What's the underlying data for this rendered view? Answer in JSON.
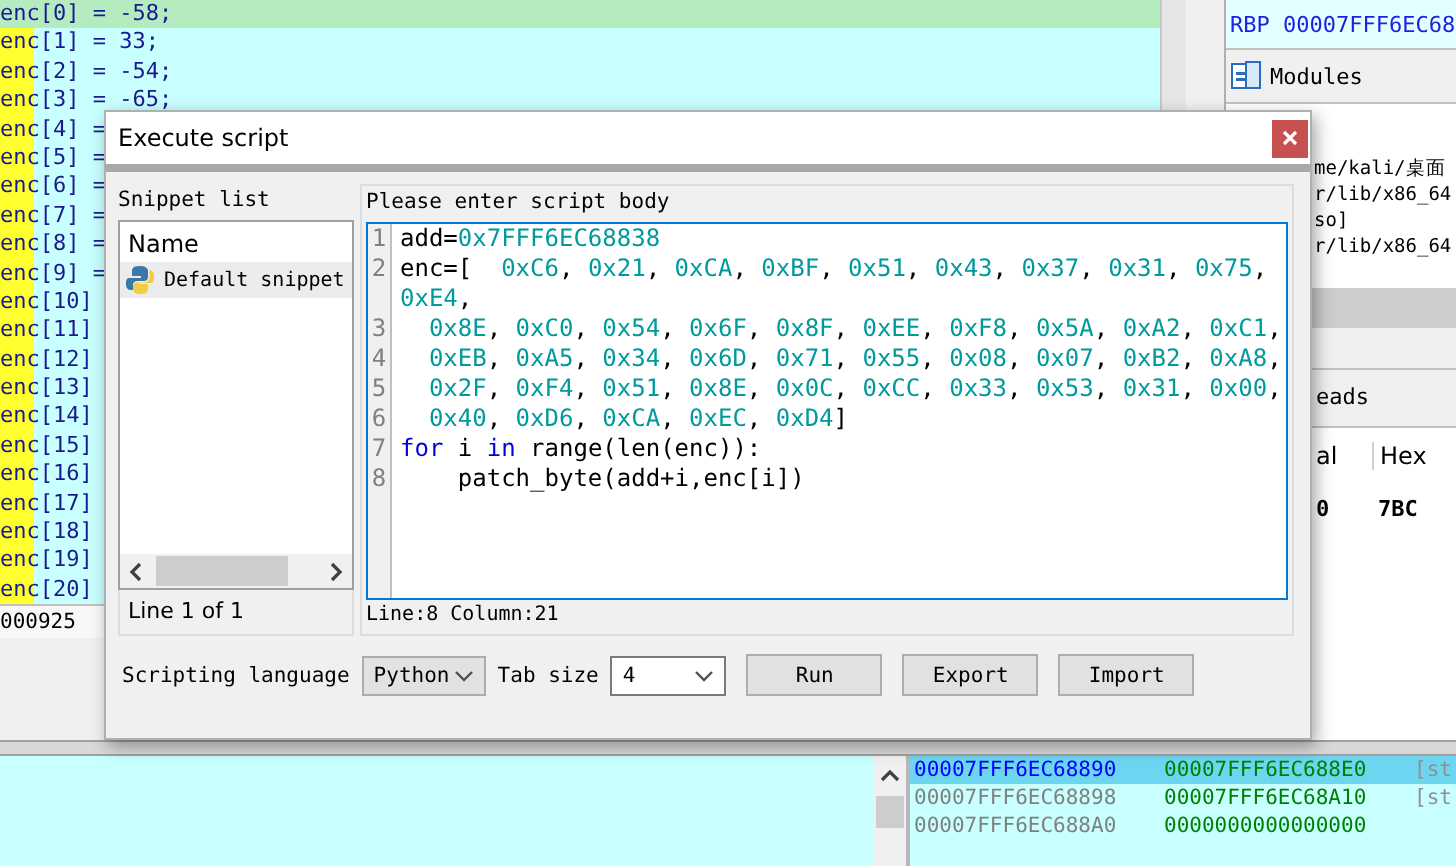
{
  "pseudocode": {
    "lines": [
      {
        "text": "enc[0] = -58;",
        "selected": true
      },
      {
        "text": "enc[1] = 33;",
        "selected": false
      },
      {
        "text": "enc[2] = -54;",
        "selected": false
      },
      {
        "text": "enc[3] = -65;",
        "selected": false
      },
      {
        "text": "enc[4] =",
        "selected": false
      },
      {
        "text": "enc[5] =",
        "selected": false
      },
      {
        "text": "enc[6] =",
        "selected": false
      },
      {
        "text": "enc[7] =",
        "selected": false
      },
      {
        "text": "enc[8] =",
        "selected": false
      },
      {
        "text": "enc[9] =",
        "selected": false
      },
      {
        "text": "enc[10]",
        "selected": false
      },
      {
        "text": "enc[11]",
        "selected": false
      },
      {
        "text": "enc[12]",
        "selected": false
      },
      {
        "text": "enc[13]",
        "selected": false
      },
      {
        "text": "enc[14]",
        "selected": false
      },
      {
        "text": "enc[15]",
        "selected": false
      },
      {
        "text": "enc[16]",
        "selected": false
      },
      {
        "text": "enc[17]",
        "selected": false
      },
      {
        "text": "enc[18]",
        "selected": false
      },
      {
        "text": "enc[19]",
        "selected": false
      },
      {
        "text": "enc[20]",
        "selected": false
      }
    ],
    "status": "000925"
  },
  "registers": {
    "line": "RBP 00007FFF6EC68"
  },
  "modules": {
    "title": "Modules",
    "items": [
      "me/kali/桌面",
      "r/lib/x86_64",
      "so]",
      "r/lib/x86_64"
    ]
  },
  "threads": {
    "tab": "eads",
    "columns": [
      "al",
      "Hex"
    ],
    "rows": [
      [
        "0",
        "7BC"
      ]
    ]
  },
  "hex_dump": {
    "rows": [
      {
        "address": "00007FFF6EC68890",
        "value": "00007FFF6EC688E0",
        "comment": "[st",
        "selected": true
      },
      {
        "address": "00007FFF6EC68898",
        "value": "00007FFF6EC68A10",
        "comment": "[st",
        "selected": false
      },
      {
        "address": "00007FFF6EC688A0",
        "value": "0000000000000000",
        "selected": false
      }
    ]
  },
  "dialog": {
    "title": "Execute script",
    "snippet_list": {
      "label": "Snippet list",
      "column": "Name",
      "items": [
        {
          "name": "Default snippet",
          "selected": true
        }
      ],
      "status": "Line 1 of 1"
    },
    "editor": {
      "label": "Please enter script body",
      "lines": [
        {
          "number": "1",
          "tokens": [
            {
              "kind": "plain",
              "text": "add="
            },
            {
              "kind": "number",
              "text": "0x7FFF6EC68838"
            }
          ]
        },
        {
          "number": "2",
          "tokens": [
            {
              "kind": "plain",
              "text": "enc=[  "
            },
            {
              "kind": "number",
              "text": "0xC6"
            },
            {
              "kind": "plain",
              "text": ", "
            },
            {
              "kind": "number",
              "text": "0x21"
            },
            {
              "kind": "plain",
              "text": ", "
            },
            {
              "kind": "number",
              "text": "0xCA"
            },
            {
              "kind": "plain",
              "text": ", "
            },
            {
              "kind": "number",
              "text": "0xBF"
            },
            {
              "kind": "plain",
              "text": ", "
            },
            {
              "kind": "number",
              "text": "0x51"
            },
            {
              "kind": "plain",
              "text": ", "
            },
            {
              "kind": "number",
              "text": "0x43"
            },
            {
              "kind": "plain",
              "text": ", "
            },
            {
              "kind": "number",
              "text": "0x37"
            },
            {
              "kind": "plain",
              "text": ", "
            },
            {
              "kind": "number",
              "text": "0x31"
            },
            {
              "kind": "plain",
              "text": ", "
            },
            {
              "kind": "number",
              "text": "0x75"
            },
            {
              "kind": "plain",
              "text": ", "
            },
            {
              "kind": "number",
              "text": "0xE4"
            },
            {
              "kind": "plain",
              "text": ","
            }
          ]
        },
        {
          "number": "3",
          "indented": true,
          "tokens": [
            {
              "kind": "number",
              "text": "0x8E"
            },
            {
              "kind": "plain",
              "text": ", "
            },
            {
              "kind": "number",
              "text": "0xC0"
            },
            {
              "kind": "plain",
              "text": ", "
            },
            {
              "kind": "number",
              "text": "0x54"
            },
            {
              "kind": "plain",
              "text": ", "
            },
            {
              "kind": "number",
              "text": "0x6F"
            },
            {
              "kind": "plain",
              "text": ", "
            },
            {
              "kind": "number",
              "text": "0x8F"
            },
            {
              "kind": "plain",
              "text": ", "
            },
            {
              "kind": "number",
              "text": "0xEE"
            },
            {
              "kind": "plain",
              "text": ", "
            },
            {
              "kind": "number",
              "text": "0xF8"
            },
            {
              "kind": "plain",
              "text": ", "
            },
            {
              "kind": "number",
              "text": "0x5A"
            },
            {
              "kind": "plain",
              "text": ", "
            },
            {
              "kind": "number",
              "text": "0xA2"
            },
            {
              "kind": "plain",
              "text": ", "
            },
            {
              "kind": "number",
              "text": "0xC1"
            },
            {
              "kind": "plain",
              "text": ","
            }
          ]
        },
        {
          "number": "4",
          "indented": true,
          "tokens": [
            {
              "kind": "number",
              "text": "0xEB"
            },
            {
              "kind": "plain",
              "text": ", "
            },
            {
              "kind": "number",
              "text": "0xA5"
            },
            {
              "kind": "plain",
              "text": ", "
            },
            {
              "kind": "number",
              "text": "0x34"
            },
            {
              "kind": "plain",
              "text": ", "
            },
            {
              "kind": "number",
              "text": "0x6D"
            },
            {
              "kind": "plain",
              "text": ", "
            },
            {
              "kind": "number",
              "text": "0x71"
            },
            {
              "kind": "plain",
              "text": ", "
            },
            {
              "kind": "number",
              "text": "0x55"
            },
            {
              "kind": "plain",
              "text": ", "
            },
            {
              "kind": "number",
              "text": "0x08"
            },
            {
              "kind": "plain",
              "text": ", "
            },
            {
              "kind": "number",
              "text": "0x07"
            },
            {
              "kind": "plain",
              "text": ", "
            },
            {
              "kind": "number",
              "text": "0xB2"
            },
            {
              "kind": "plain",
              "text": ", "
            },
            {
              "kind": "number",
              "text": "0xA8"
            },
            {
              "kind": "plain",
              "text": ","
            }
          ]
        },
        {
          "number": "5",
          "indented": true,
          "tokens": [
            {
              "kind": "number",
              "text": "0x2F"
            },
            {
              "kind": "plain",
              "text": ", "
            },
            {
              "kind": "number",
              "text": "0xF4"
            },
            {
              "kind": "plain",
              "text": ", "
            },
            {
              "kind": "number",
              "text": "0x51"
            },
            {
              "kind": "plain",
              "text": ", "
            },
            {
              "kind": "number",
              "text": "0x8E"
            },
            {
              "kind": "plain",
              "text": ", "
            },
            {
              "kind": "number",
              "text": "0x0C"
            },
            {
              "kind": "plain",
              "text": ", "
            },
            {
              "kind": "number",
              "text": "0xCC"
            },
            {
              "kind": "plain",
              "text": ", "
            },
            {
              "kind": "number",
              "text": "0x33"
            },
            {
              "kind": "plain",
              "text": ", "
            },
            {
              "kind": "number",
              "text": "0x53"
            },
            {
              "kind": "plain",
              "text": ", "
            },
            {
              "kind": "number",
              "text": "0x31"
            },
            {
              "kind": "plain",
              "text": ", "
            },
            {
              "kind": "number",
              "text": "0x00"
            },
            {
              "kind": "plain",
              "text": ","
            }
          ]
        },
        {
          "number": "6",
          "indented": true,
          "tokens": [
            {
              "kind": "number",
              "text": "0x40"
            },
            {
              "kind": "plain",
              "text": ", "
            },
            {
              "kind": "number",
              "text": "0xD6"
            },
            {
              "kind": "plain",
              "text": ", "
            },
            {
              "kind": "number",
              "text": "0xCA"
            },
            {
              "kind": "plain",
              "text": ", "
            },
            {
              "kind": "number",
              "text": "0xEC"
            },
            {
              "kind": "plain",
              "text": ", "
            },
            {
              "kind": "number",
              "text": "0xD4"
            },
            {
              "kind": "plain",
              "text": "]"
            }
          ]
        },
        {
          "number": "7",
          "tokens": [
            {
              "kind": "keyword",
              "text": "for"
            },
            {
              "kind": "plain",
              "text": " i "
            },
            {
              "kind": "keyword",
              "text": "in"
            },
            {
              "kind": "plain",
              "text": " range(len(enc)):"
            }
          ]
        },
        {
          "number": "8",
          "tokens": [
            {
              "kind": "plain",
              "text": "    patch_byte(add+i,enc[i])"
            }
          ]
        }
      ],
      "status": "Line:8  Column:21"
    },
    "language": {
      "label": "Scripting language",
      "value": "Python"
    },
    "tab_size": {
      "label": "Tab size",
      "value": "4"
    },
    "buttons": [
      "Run",
      "Export",
      "Import"
    ]
  }
}
